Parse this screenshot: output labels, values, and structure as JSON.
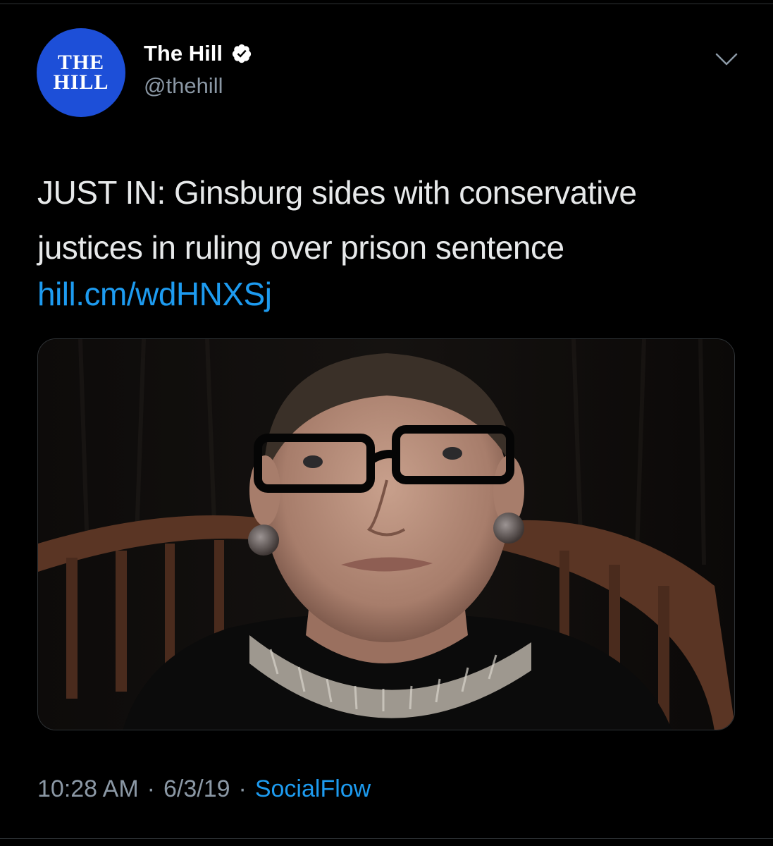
{
  "author": {
    "avatar_line1": "THE",
    "avatar_line2": "HILL",
    "display_name": "The Hill",
    "handle": "@thehill",
    "verified": true,
    "avatar_color": "#1d4fd8"
  },
  "tweet": {
    "text": "JUST IN: Ginsburg sides with conservative justices in ruling over prison sentence",
    "link": "hill.cm/wdHNXSj",
    "link_color": "#1d9bf0"
  },
  "meta": {
    "time": "10:28 AM",
    "separator": "·",
    "date": "6/3/19",
    "source": "SocialFlow"
  },
  "icons": {
    "verified": "verified-badge-icon",
    "more": "chevron-down-icon"
  }
}
